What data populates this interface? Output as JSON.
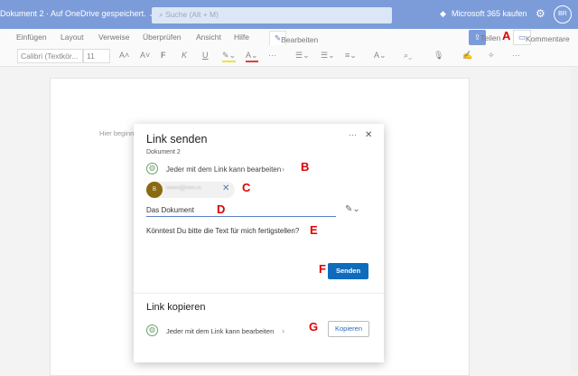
{
  "titlebar": {
    "doc_title": "Dokument 2 · Auf OneDrive gespeichert. ⌄",
    "search_placeholder": "Suche (Alt + M)",
    "buy": "Microsoft 365 kaufen",
    "avatar": "BR"
  },
  "tabs": [
    "Einfügen",
    "Layout",
    "Verweise",
    "Überprüfen",
    "Ansicht",
    "Hilfe"
  ],
  "edit_mode": "Bearbeiten ⌄",
  "share": "Teilen",
  "comments": "Kommentare",
  "toolbar": {
    "font": "Calibri (Textkör...",
    "size": "11",
    "bold": "F",
    "italic": "K",
    "underline": "U",
    "more": "···"
  },
  "page": {
    "placeholder": "Hier beginn"
  },
  "dialog": {
    "title": "Link senden",
    "subtitle": "Dokument 2",
    "more": "···",
    "close": "✕",
    "permission": "Jeder mit dem Link kann bearbeiten",
    "recipient_initial": "B",
    "recipient": "••••••@••••.••",
    "subject": "Das Dokument",
    "message": "Könntest Du bitte die Text für mich fertigstellen?",
    "send": "Senden",
    "copy_title": "Link kopieren",
    "copy_permission": "Jeder mit dem Link kann bearbeiten",
    "copy": "Kopieren"
  },
  "annotations": {
    "a": "A",
    "b": "B",
    "c": "C",
    "d": "D",
    "e": "E",
    "f": "F",
    "g": "G"
  },
  "colors": {
    "titlebar": "#7c9cd9",
    "primary": "#0f6cbd",
    "annotation": "#e00000"
  }
}
